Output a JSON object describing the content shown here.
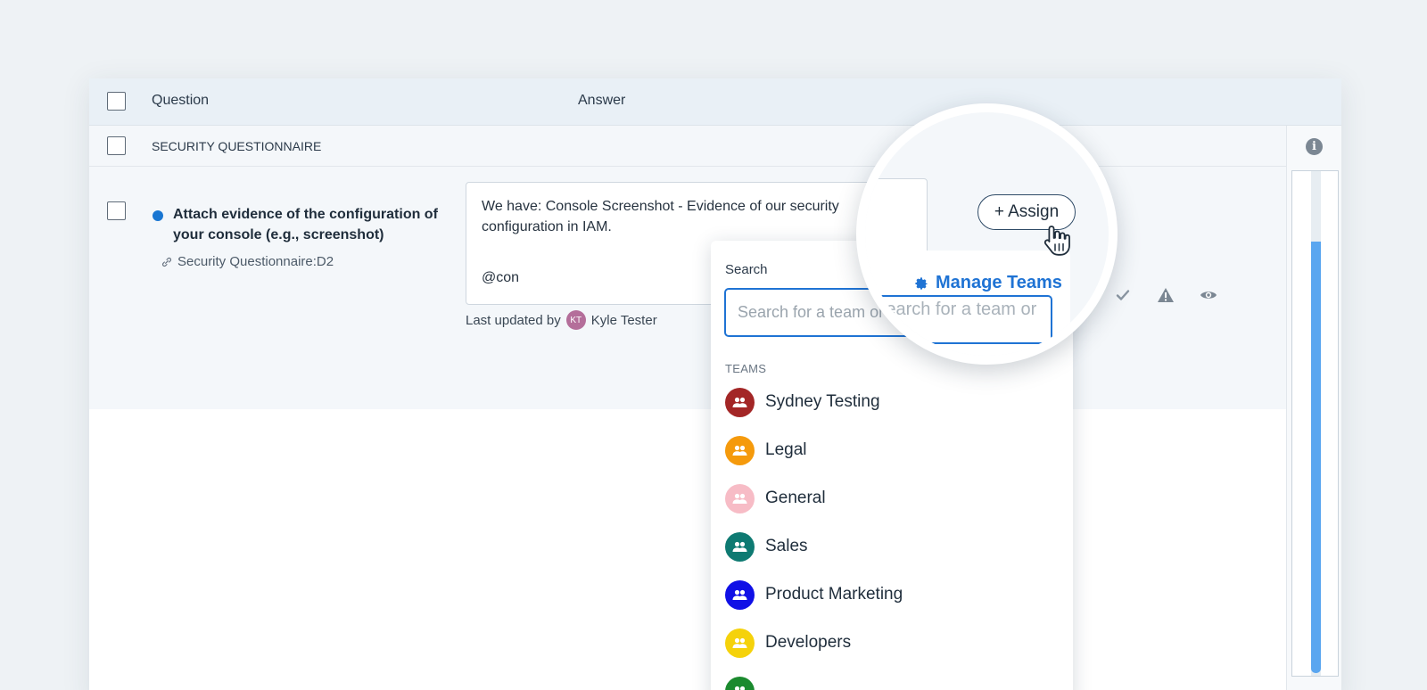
{
  "table": {
    "header": {
      "question": "Question",
      "answer": "Answer"
    },
    "section_title": "SECURITY QUESTIONNAIRE",
    "row": {
      "question": "Attach evidence of the configuration of your console (e.g., screenshot)",
      "reference": "Security Questionnaire:D2",
      "answer_text": "We have: Console Screenshot - Evidence of our security configuration in IAM.",
      "answer_mention": "@con",
      "last_updated_label": "Last updated by",
      "last_updated_initials": "KT",
      "last_updated_name": "Kyle Tester"
    }
  },
  "assign": {
    "button_label": "+ Assign",
    "manage_teams_label": "Manage Teams"
  },
  "dropdown": {
    "search_label": "Search",
    "search_placeholder": "Search for a team or",
    "magnified_placeholder_fragment": "Search for a team or",
    "teams_label": "TEAMS",
    "teams": [
      {
        "name": "Sydney Testing",
        "color": "#a32626"
      },
      {
        "name": "Legal",
        "color": "#f59a0c"
      },
      {
        "name": "General",
        "color": "#f7bcc6"
      },
      {
        "name": "Sales",
        "color": "#0e7a72"
      },
      {
        "name": "Product Marketing",
        "color": "#1010e6"
      },
      {
        "name": "Developers",
        "color": "#f5d20b"
      },
      {
        "name": "",
        "color": "#1b8a2e"
      }
    ]
  },
  "icons": {
    "check": "check-icon",
    "warning": "warning-icon",
    "preview": "eye-icon",
    "info": "info-icon",
    "link": "link-icon",
    "gear": "gear-icon",
    "team": "team-icon",
    "cursor": "hand-cursor-icon"
  },
  "colors": {
    "accent": "#1f73d4",
    "scroll_thumb": "#5aa6f0",
    "unread_dot": "#1976d2"
  }
}
